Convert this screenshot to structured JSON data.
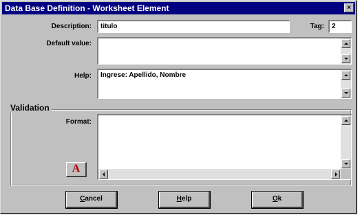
{
  "window": {
    "title": "Data Base Definition - Worksheet Element",
    "close_glyph": "×"
  },
  "fields": {
    "description": {
      "label": "Description:",
      "value": "titulo"
    },
    "tag": {
      "label": "Tag:",
      "value": "2"
    },
    "default_value": {
      "label": "Default value:",
      "value": ""
    },
    "help": {
      "label": "Help:",
      "value": "Ingrese: Apellido, Nombre"
    }
  },
  "validation": {
    "group_label": "Validation",
    "format_label": "Format:",
    "format_value": "",
    "font_button_glyph": "A",
    "font_button_color": "#b00000"
  },
  "buttons": {
    "cancel_prefix": "C",
    "cancel_rest": "ancel",
    "help_prefix": "H",
    "help_rest": "elp",
    "ok_prefix": "O",
    "ok_rest": "k"
  },
  "colors": {
    "titlebar": "#000080",
    "face": "#c0c0c0"
  }
}
